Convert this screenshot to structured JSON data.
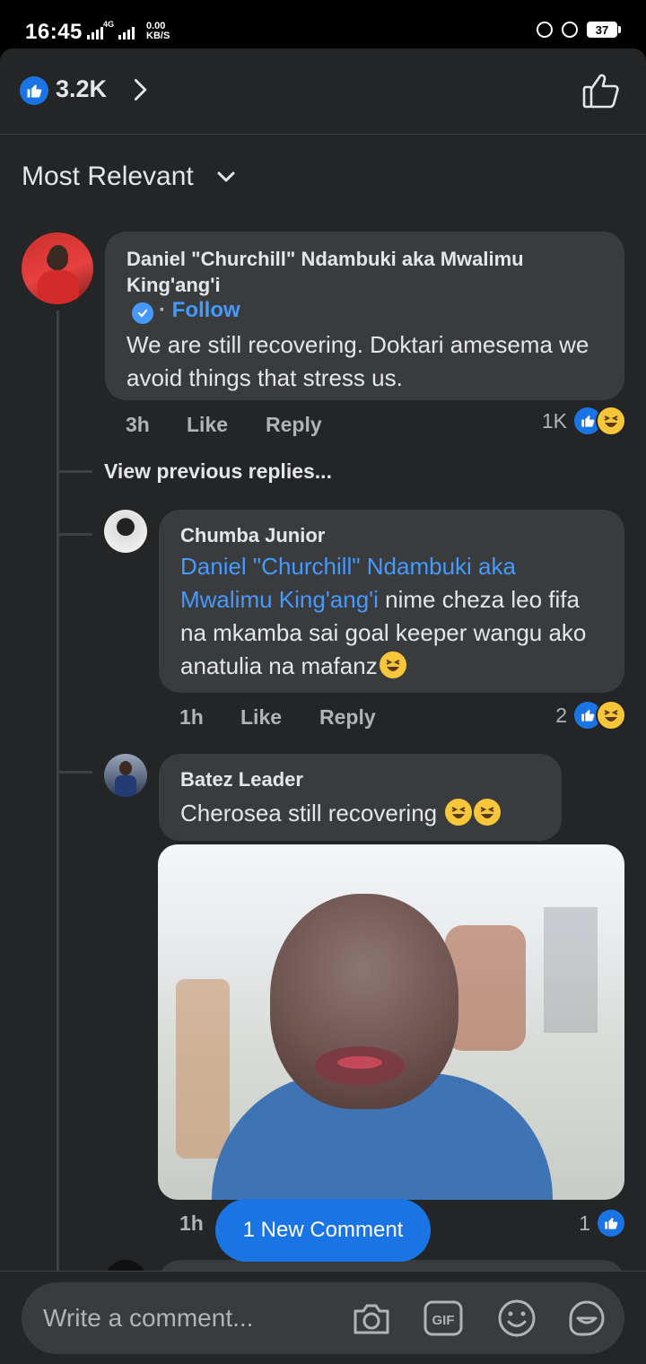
{
  "status_bar": {
    "time": "16:45",
    "network": "4G",
    "speed_value": "0.00",
    "speed_unit": "KB/S",
    "battery": "37"
  },
  "header": {
    "like_count": "3.2K"
  },
  "sort": {
    "label": "Most Relevant"
  },
  "comments": [
    {
      "author": "Daniel \"Churchill\" Ndambuki aka Mwalimu King'ang'i",
      "follow_label": "Follow",
      "text": "We are still recovering. Doktari amesema we avoid things that stress us.",
      "time": "3h",
      "like_label": "Like",
      "reply_label": "Reply",
      "reaction_count": "1K"
    }
  ],
  "view_previous_replies": "View previous replies...",
  "replies": [
    {
      "author": "Chumba Junior",
      "mention": "Daniel \"Churchill\" Ndambuki aka Mwalimu King'ang'i",
      "text": "nime cheza leo fifa na mkamba sai goal keeper wangu ako anatulia na mafanz",
      "time": "1h",
      "like_label": "Like",
      "reply_label": "Reply",
      "reaction_count": "2"
    },
    {
      "author": "Batez Leader",
      "text": "Cherosea still recovering",
      "time": "1h",
      "reaction_count": "1"
    }
  ],
  "new_comment_pill": "1 New Comment",
  "composer": {
    "placeholder": "Write a comment..."
  },
  "colors": {
    "background": "#242526",
    "bubble": "#3a3b3c",
    "accent": "#1b74e4",
    "link": "#4599ff",
    "secondary_text": "#b0b3b8"
  },
  "icons": [
    "like-reaction-icon",
    "chevron-right-icon",
    "thumbs-up-outline-icon",
    "chevron-down-icon",
    "verified-badge-icon",
    "haha-reaction-icon",
    "camera-icon",
    "gif-icon",
    "emoji-icon",
    "sticker-icon"
  ]
}
